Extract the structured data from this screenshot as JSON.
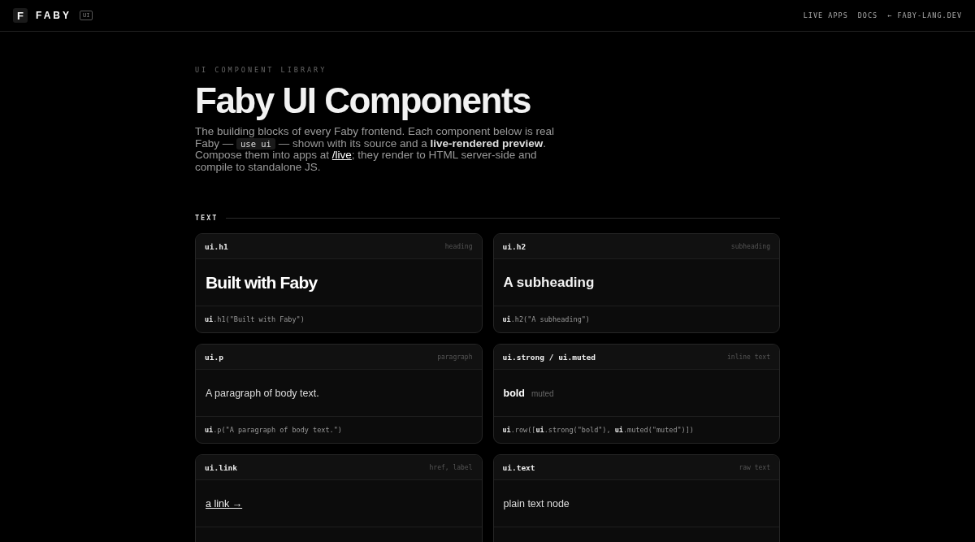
{
  "header": {
    "logo_letter": "F",
    "brand": "FABY",
    "badge": "UI",
    "nav": [
      "LIVE APPS",
      "DOCS",
      "← FABY-LANG.DEV"
    ]
  },
  "eyebrow": "UI COMPONENT LIBRARY",
  "title": "Faby UI Components",
  "intro": [
    {
      "kind": "text",
      "text": "The building blocks of every Faby frontend. Each component below is real Faby — "
    },
    {
      "kind": "code",
      "text": "use ui"
    },
    {
      "kind": "text",
      "text": " — shown with its source and a "
    },
    {
      "kind": "bold",
      "text": "live-rendered preview"
    },
    {
      "kind": "text",
      "text": ". Compose them into apps at "
    },
    {
      "kind": "link",
      "text": "/live"
    },
    {
      "kind": "text",
      "text": "; they render to HTML server-side and compile to standalone JS."
    }
  ],
  "section": "TEXT",
  "cards": [
    {
      "name": "ui.h1",
      "tag": "heading",
      "kind": "h1",
      "preview": [
        "Built with Faby"
      ],
      "code": "**ui**.h1(\"Built with Faby\")"
    },
    {
      "name": "ui.h2",
      "tag": "subheading",
      "kind": "h2",
      "preview": [
        "A subheading"
      ],
      "code": "**ui**.h2(\"A subheading\")"
    },
    {
      "name": "ui.p",
      "tag": "paragraph",
      "kind": "p",
      "preview": [
        "A paragraph of body text."
      ],
      "code": "**ui**.p(\"A paragraph of body text.\")"
    },
    {
      "name": "ui.strong / ui.muted",
      "tag": "inline text",
      "kind": "strong_muted",
      "preview": [
        "bold",
        "muted"
      ],
      "code": "**ui**.row([**ui**.strong(\"bold\"), **ui**.muted(\"muted\")])"
    },
    {
      "name": "ui.link",
      "tag": "href, label",
      "kind": "link",
      "preview": [
        "a link →"
      ]
    },
    {
      "name": "ui.text",
      "tag": "raw text",
      "kind": "text",
      "preview": [
        "plain text node"
      ]
    }
  ]
}
